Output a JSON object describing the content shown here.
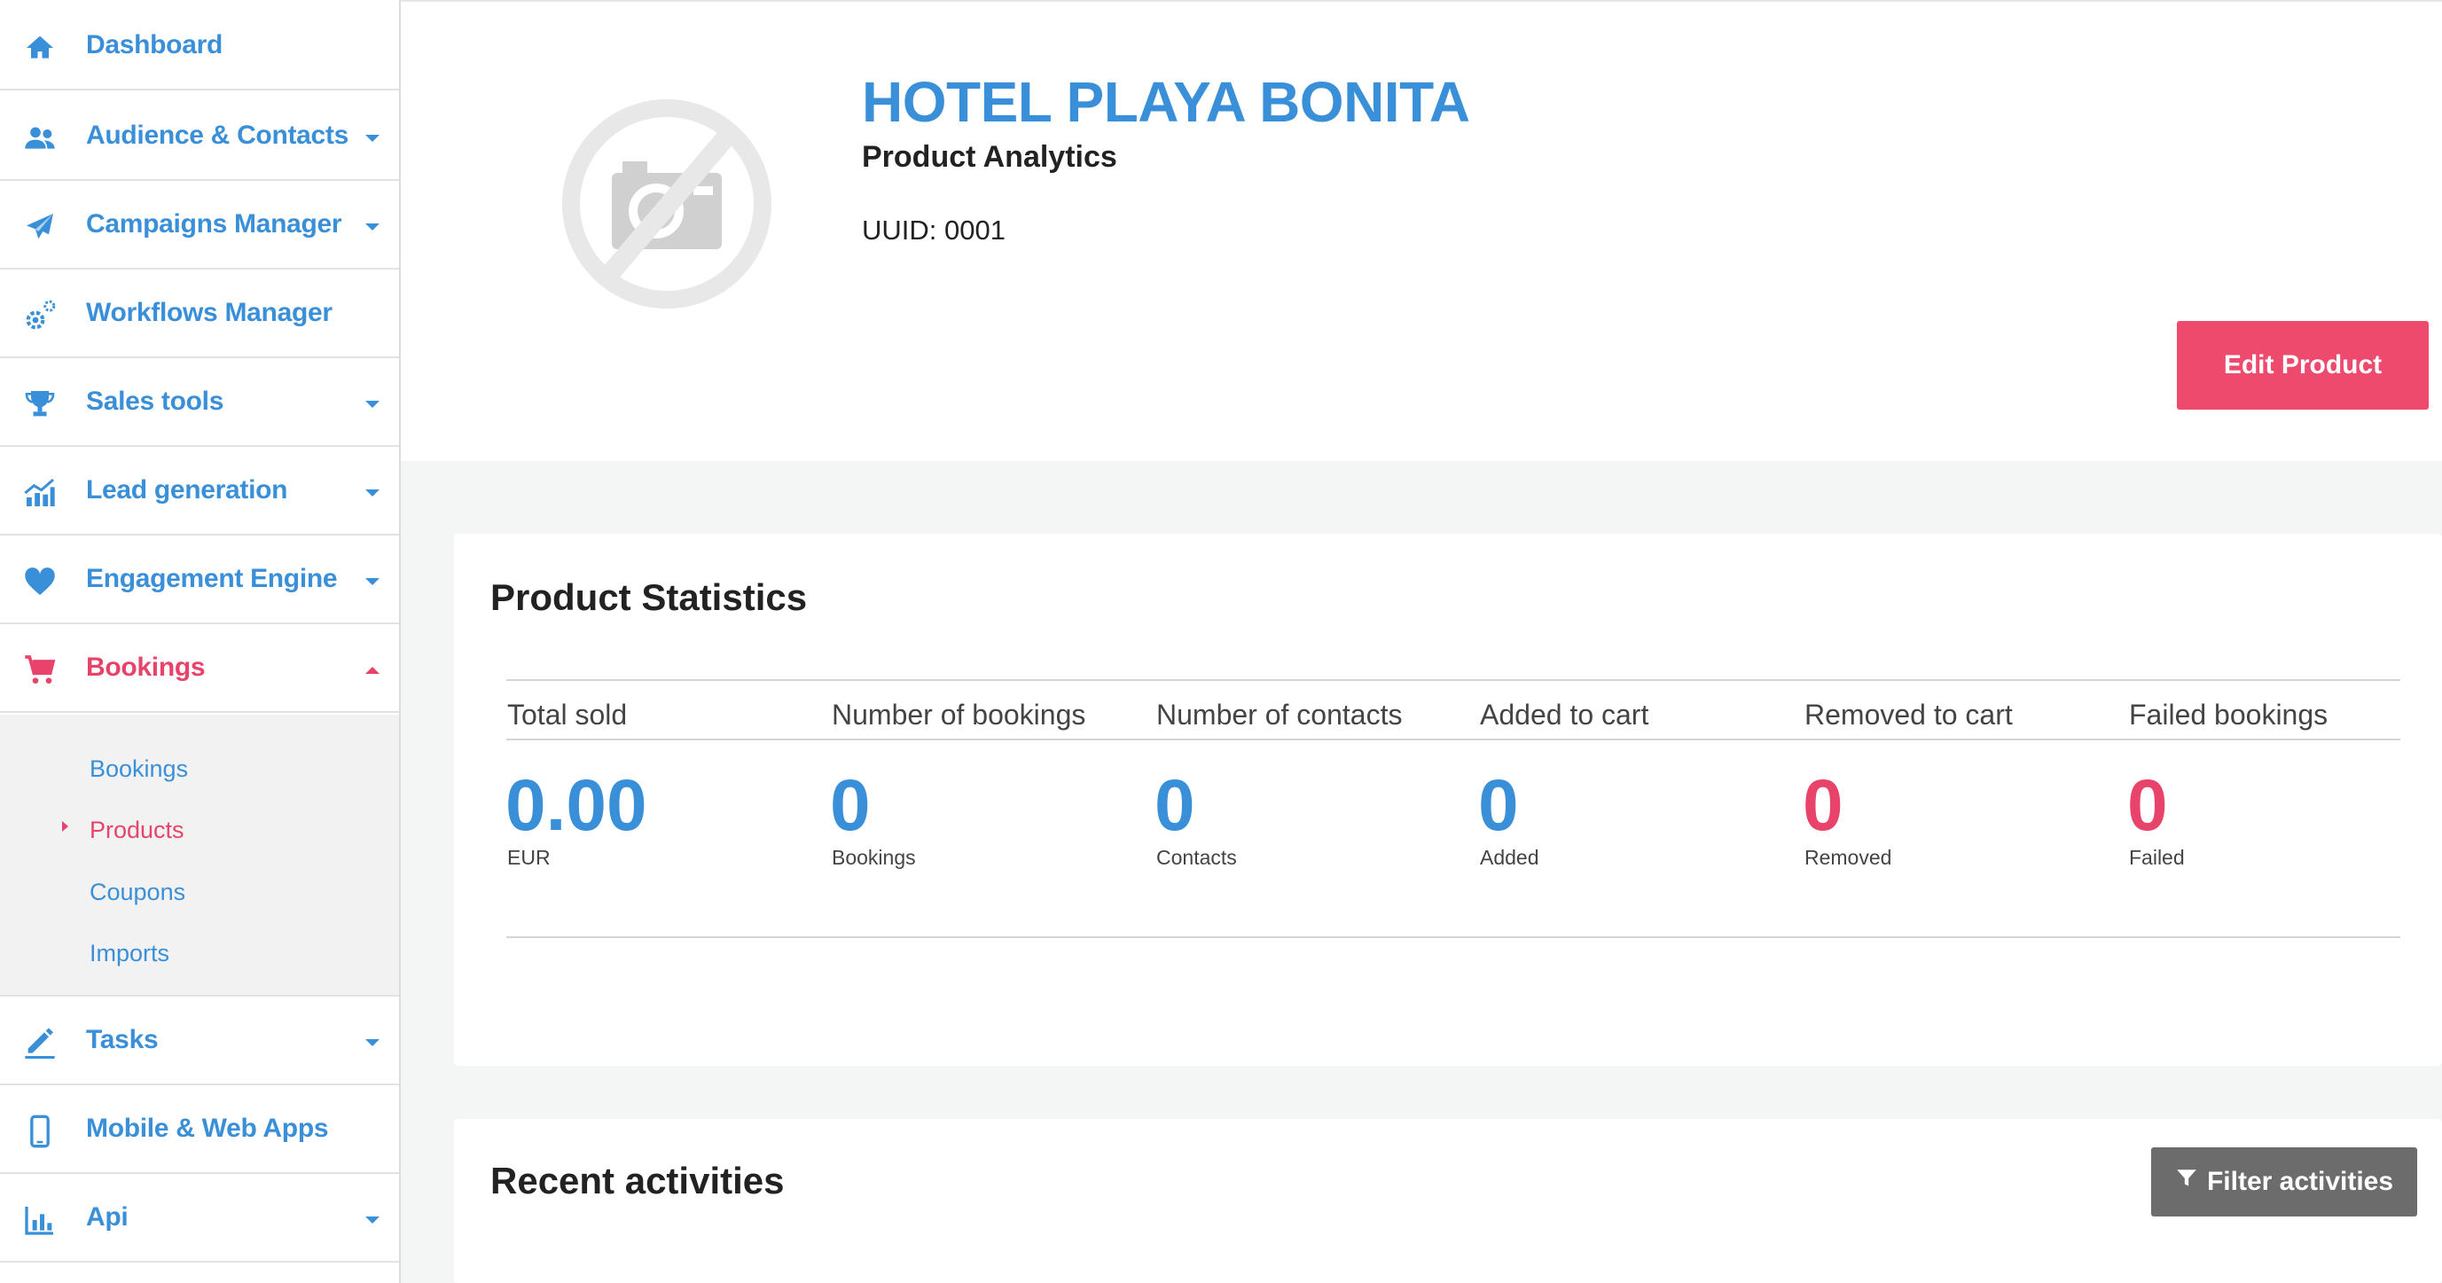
{
  "sidebar": {
    "items": [
      {
        "label": "Dashboard",
        "icon": "home-icon",
        "has_caret": false
      },
      {
        "label": "Audience & Contacts",
        "icon": "users-icon",
        "has_caret": true
      },
      {
        "label": "Campaigns Manager",
        "icon": "paper-plane-icon",
        "has_caret": true
      },
      {
        "label": "Workflows Manager",
        "icon": "gears-icon",
        "has_caret": false
      },
      {
        "label": "Sales tools",
        "icon": "trophy-icon",
        "has_caret": true
      },
      {
        "label": "Lead generation",
        "icon": "chart-line-icon",
        "has_caret": true
      },
      {
        "label": "Engagement Engine",
        "icon": "heart-icon",
        "has_caret": true
      },
      {
        "label": "Bookings",
        "icon": "cart-icon",
        "has_caret": true,
        "expanded": true
      },
      {
        "label": "Tasks",
        "icon": "pencil-icon",
        "has_caret": true
      },
      {
        "label": "Mobile & Web Apps",
        "icon": "mobile-icon",
        "has_caret": false
      },
      {
        "label": "Api",
        "icon": "bar-chart-icon",
        "has_caret": true
      }
    ],
    "submenu": [
      {
        "label": "Bookings"
      },
      {
        "label": "Products",
        "active": true
      },
      {
        "label": "Coupons"
      },
      {
        "label": "Imports"
      }
    ]
  },
  "product": {
    "name": "HOTEL PLAYA BONITA",
    "subtitle": "Product Analytics",
    "uuid_label": "UUID: 0001",
    "image_icon": "no-photo-icon",
    "edit_label": "Edit Product"
  },
  "stats": {
    "title": "Product Statistics",
    "columns": [
      {
        "header": "Total sold",
        "value": "0.00",
        "unit": "EUR",
        "color": "#3a8fd9"
      },
      {
        "header": "Number of bookings",
        "value": "0",
        "unit": "Bookings",
        "color": "#3a8fd9"
      },
      {
        "header": "Number of contacts",
        "value": "0",
        "unit": "Contacts",
        "color": "#3a8fd9"
      },
      {
        "header": "Added to cart",
        "value": "0",
        "unit": "Added",
        "color": "#3a8fd9"
      },
      {
        "header": "Removed to cart",
        "value": "0",
        "unit": "Removed",
        "color": "#e8436b"
      },
      {
        "header": "Failed bookings",
        "value": "0",
        "unit": "Failed",
        "color": "#e8436b"
      }
    ]
  },
  "activities": {
    "title": "Recent activities",
    "filter_label": "Filter activities",
    "filter_icon": "filter-icon"
  },
  "colors": {
    "accent_blue": "#3a8fd9",
    "accent_pink": "#e8436b",
    "button_pink": "#ed4a6d",
    "button_gray": "#6c6c6c"
  }
}
